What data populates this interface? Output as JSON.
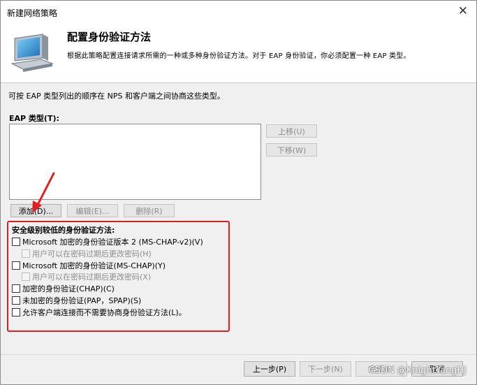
{
  "window": {
    "title": "新建网络策略",
    "close_glyph": "✕"
  },
  "header": {
    "title": "配置身份验证方法",
    "description": "根据此策略配置连接请求所需的一种或多种身份验证方法。对于 EAP 身份验证，你必须配置一种 EAP 类型。",
    "icon": "computer-monitor-icon"
  },
  "intro": "可按 EAP 类型列出的顺序在 NPS 和客户端之间协商这些类型。",
  "eap": {
    "label": "EAP 类型(T):",
    "move_up": "上移(U)",
    "move_down": "下移(W)",
    "add": "添加(D)...",
    "edit": "编辑(E)...",
    "remove": "删除(R)"
  },
  "auth": {
    "title": "安全级别较低的身份验证方法:",
    "options": [
      {
        "label": "Microsoft 加密的身份验证版本 2 (MS-CHAP-v2)(V)",
        "checked": false,
        "enabled": true
      },
      {
        "label": "用户可以在密码过期后更改密码(H)",
        "checked": false,
        "enabled": false
      },
      {
        "label": "Microsoft 加密的身份验证(MS-CHAP)(Y)",
        "checked": false,
        "enabled": true
      },
      {
        "label": "用户可以在密码过期后更改密码(X)",
        "checked": false,
        "enabled": false
      },
      {
        "label": "加密的身份验证(CHAP)(C)",
        "checked": false,
        "enabled": true
      },
      {
        "label": "未加密的身份验证(PAP，SPAP)(S)",
        "checked": false,
        "enabled": true
      },
      {
        "label": "允许客户端连接而不需要协商身份验证方法(L)。",
        "checked": false,
        "enabled": true
      }
    ]
  },
  "footer": {
    "prev": "上一步(P)",
    "next": "下一步(N)",
    "finish": "完成(F)",
    "cancel": "取消"
  },
  "watermark": "CSDN @KnightYangHJ",
  "colors": {
    "annotation": "#e02020"
  }
}
